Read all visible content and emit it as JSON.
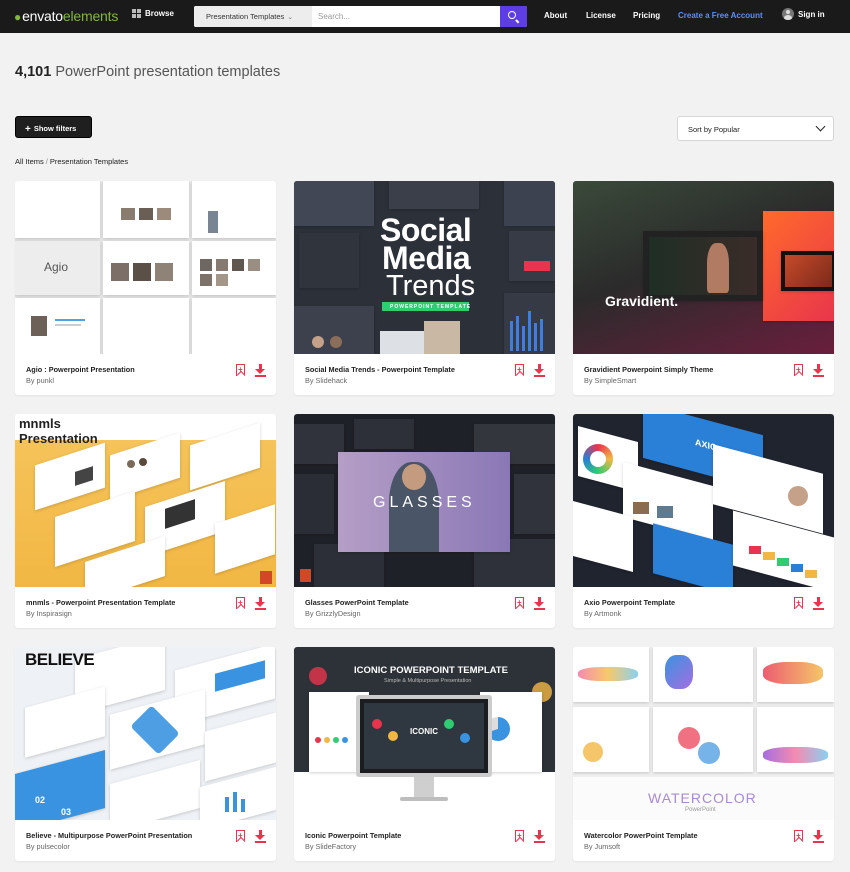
{
  "brand": {
    "part1": "envato",
    "part2": "elements",
    "accent_color": "#82b541"
  },
  "nav": {
    "browse_label": "Browse",
    "category_select": "Presentation Templates",
    "search_placeholder": "Search...",
    "links": [
      "About",
      "License",
      "Pricing",
      "Create a Free Account"
    ],
    "signin_label": "Sign in",
    "search_button_color": "#5d3ee5"
  },
  "results": {
    "count": "4,101",
    "title_rest": "PowerPoint presentation templates"
  },
  "filters": {
    "show_label": "Show filters"
  },
  "sort": {
    "selected": "Sort by Popular"
  },
  "breadcrumb": [
    "All Items",
    "Presentation Templates"
  ],
  "accent_red": "#e8344d",
  "cards": [
    {
      "title": "Agio : Powerpoint Presentation",
      "author": "By punkl",
      "thumb_text": "Agio"
    },
    {
      "title": "Social Media Trends - Powerpoint Template",
      "author": "By Slidehack",
      "thumb_text": [
        "Social",
        "Media",
        "Trends",
        "POWERPOINT TEMPLATE"
      ]
    },
    {
      "title": "Gravidient Powerpoint Simply Theme",
      "author": "By SimpleSmart",
      "thumb_text": "Gravidient."
    },
    {
      "title": "mnmls - Powerpoint Presentation Template",
      "author": "By Inspirasign",
      "thumb_text": [
        "mnmls",
        "Presentation"
      ]
    },
    {
      "title": "Glasses PowerPoint Template",
      "author": "By GrizzlyDesign",
      "thumb_text": "GLASSES"
    },
    {
      "title": "Axio Powerpoint Template",
      "author": "By Artmonk",
      "thumb_text": "AXIO"
    },
    {
      "title": "Believe - Multipurpose PowerPoint Presentation",
      "author": "By pulsecolor",
      "thumb_text": "BELIEVE"
    },
    {
      "title": "Iconic Powerpoint Template",
      "author": "By SlideFactory",
      "thumb_text": [
        "ICONIC POWERPOINT TEMPLATE",
        "Simple & Multipurpose Presentation",
        "ICONIC"
      ]
    },
    {
      "title": "Watercolor PowerPoint Template",
      "author": "By Jumsoft",
      "thumb_text": [
        "WATERCOLOR",
        "PowerPoint"
      ]
    }
  ]
}
